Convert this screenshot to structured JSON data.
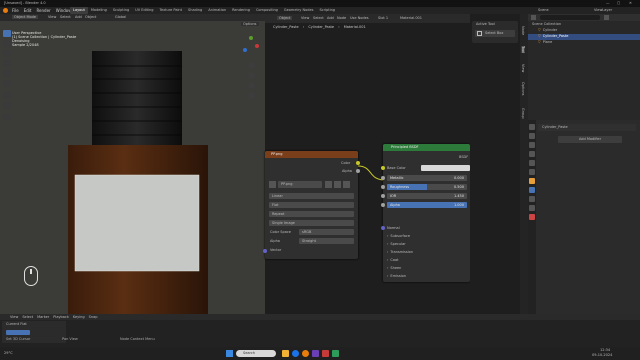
{
  "window": {
    "title": "[Unsaved] - Blender 4.0"
  },
  "menubar": {
    "menus": [
      "File",
      "Edit",
      "Render",
      "Window",
      "Help"
    ],
    "workspaces": [
      "Layout",
      "Modeling",
      "Sculpting",
      "UV Editing",
      "Texture Paint",
      "Shading",
      "Animation",
      "Rendering",
      "Compositing",
      "Geometry Nodes",
      "Scripting"
    ],
    "scene": "Scene",
    "view_layer": "ViewLayer"
  },
  "viewport": {
    "header": {
      "mode": "Object Mode",
      "menus": [
        "View",
        "Select",
        "Add",
        "Object"
      ],
      "global": "Global"
    },
    "overlay_text": [
      "User Perspective",
      "(1) Scene Collection | Cylinder_Paste",
      "Denoising",
      "Sample 2/2048"
    ],
    "options_label": "Options"
  },
  "node_editor": {
    "header": {
      "object_label": "Object",
      "menus": [
        "View",
        "Select",
        "Add",
        "Node"
      ],
      "use_nodes": "Use Nodes",
      "slot": "Slot 1",
      "material": "Material.001"
    },
    "breadcrumb": [
      "Cylinder_Paste",
      "Cylinder_Paste",
      "Material.001"
    ],
    "image_node": {
      "title": "PP.png",
      "outputs": [
        "Color",
        "Alpha"
      ],
      "image_name": "PP.png",
      "interpolation": "Linear",
      "projection": "Flat",
      "extension": "Repeat",
      "source": "Single Image",
      "color_space_label": "Color Space",
      "color_space": "sRGB",
      "alpha_label": "Alpha",
      "alpha": "Straight",
      "vector_label": "Vector"
    },
    "bsdf_node": {
      "title": "Principled BSDF",
      "output": "BSDF",
      "base_color": "Base Color",
      "fields": [
        {
          "label": "Metallic",
          "value": "0.000",
          "fill": 0
        },
        {
          "label": "Roughness",
          "value": "0.500",
          "fill": 0.5
        },
        {
          "label": "IOR",
          "value": "1.450",
          "fill": 0
        },
        {
          "label": "Alpha",
          "value": "1.000",
          "fill": 1
        }
      ],
      "normal": "Normal",
      "sections": [
        "Subsurface",
        "Specular",
        "Transmission",
        "Coat",
        "Sheen",
        "Emission"
      ]
    }
  },
  "side_panel": {
    "title": "Active Tool",
    "tool": "Select Box",
    "tabs": [
      "Node",
      "Tool",
      "View",
      "Options",
      "Group"
    ]
  },
  "outliner": {
    "search_placeholder": "",
    "items": [
      "Scene Collection",
      "Cylinder",
      "Cylinder_Paste",
      "Plane"
    ]
  },
  "properties": {
    "object": "Cylinder_Paste",
    "add_modifier": "Add Modifier"
  },
  "timeline": {
    "menus": [
      "View",
      "Select",
      "Marker",
      "Playback",
      "Keying",
      "Snap"
    ],
    "panel_title": "Current Flat",
    "frame_start": "1",
    "status_left": "Set 3D Cursor",
    "status_mid": "Pan View",
    "status_right": "Node Context Menu"
  },
  "taskbar": {
    "search_placeholder": "Search",
    "time": "12:34",
    "date": "09-10-2024",
    "weather": "29°C"
  },
  "colors": {
    "accent_blue": "#4772b3",
    "image_header": "#7a3e1a",
    "bsdf_header": "#2d7b3a",
    "socket_yellow": "#c7c729",
    "socket_gray": "#a1a1a1",
    "socket_purple": "#6363c7"
  }
}
